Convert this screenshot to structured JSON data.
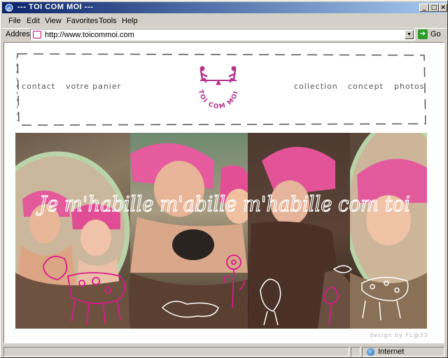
{
  "window": {
    "title": "--- TOI COM MOI ---",
    "minimize_glyph": "_",
    "maximize_glyph": "□",
    "close_glyph": "×"
  },
  "menu": {
    "items": [
      "File",
      "Edit",
      "View",
      "Favorites",
      "Tools",
      "Help"
    ]
  },
  "address": {
    "label": "Address",
    "value": "http://www.toicommoi.com",
    "dropdown_glyph": "▼",
    "go_label": "Go",
    "go_glyph": "➔"
  },
  "site": {
    "nav_left": [
      "contact",
      "votre panier"
    ],
    "nav_right": [
      "collection",
      "concept",
      "photos"
    ],
    "logo_text": "TOI COM MOI",
    "brand_color": "#b5338a",
    "handwritten_caption": "Je m'habille m'abille m'habille com toi",
    "credit": "design by FL@33"
  },
  "statusbar": {
    "zone_label": "Internet",
    "zone_icon": "globe-icon"
  }
}
